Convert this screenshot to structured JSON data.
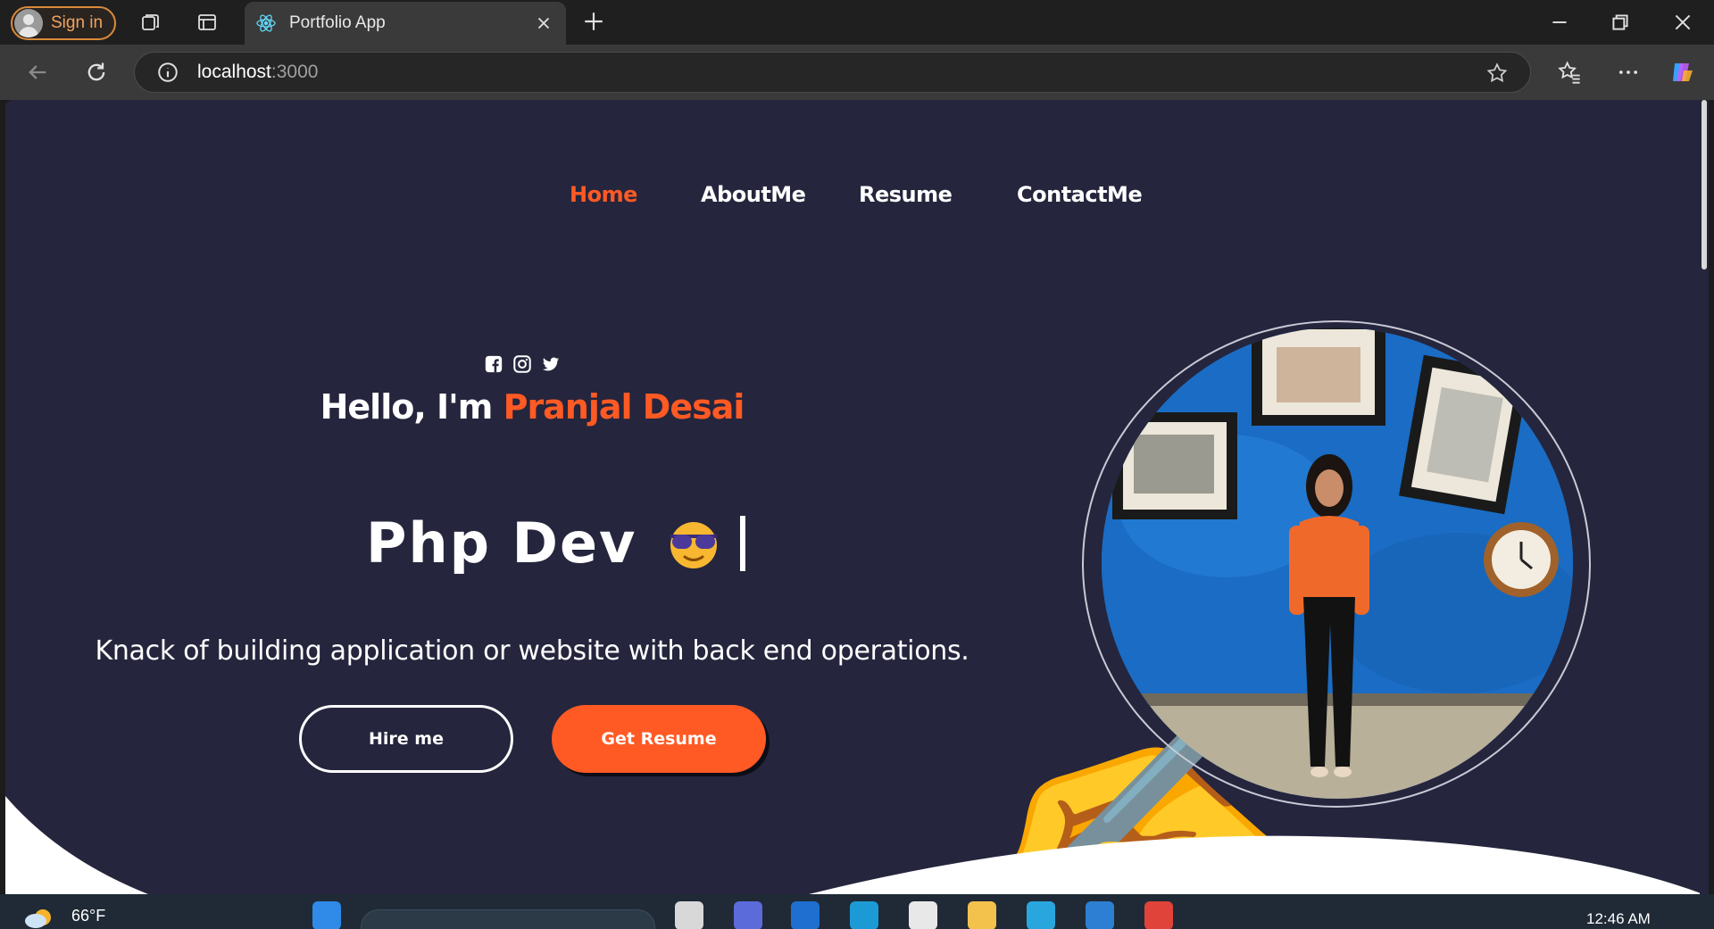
{
  "browser": {
    "profile_button_label": "Sign in",
    "tab_title": "Portfolio App",
    "url_host": "localhost",
    "url_port": ":3000"
  },
  "page": {
    "nav": [
      {
        "label": "Home",
        "active": true
      },
      {
        "label": "AboutMe",
        "active": false
      },
      {
        "label": "Resume",
        "active": false
      },
      {
        "label": "ContactMe",
        "active": false
      }
    ],
    "greeting_prefix": "Hello, I'm ",
    "greeting_name": "Pranjal Desai",
    "role_text": "Php Dev",
    "tagline": "Knack of building application or website with back end operations.",
    "hire_button": "Hire me",
    "resume_button": "Get Resume",
    "social_icons": [
      "facebook-icon",
      "instagram-icon",
      "twitter-icon"
    ],
    "accent_color": "#ff5a24",
    "background_color": "#25253d"
  },
  "taskbar": {
    "weather_temp": "66°F",
    "clock": "12:46 AM"
  }
}
